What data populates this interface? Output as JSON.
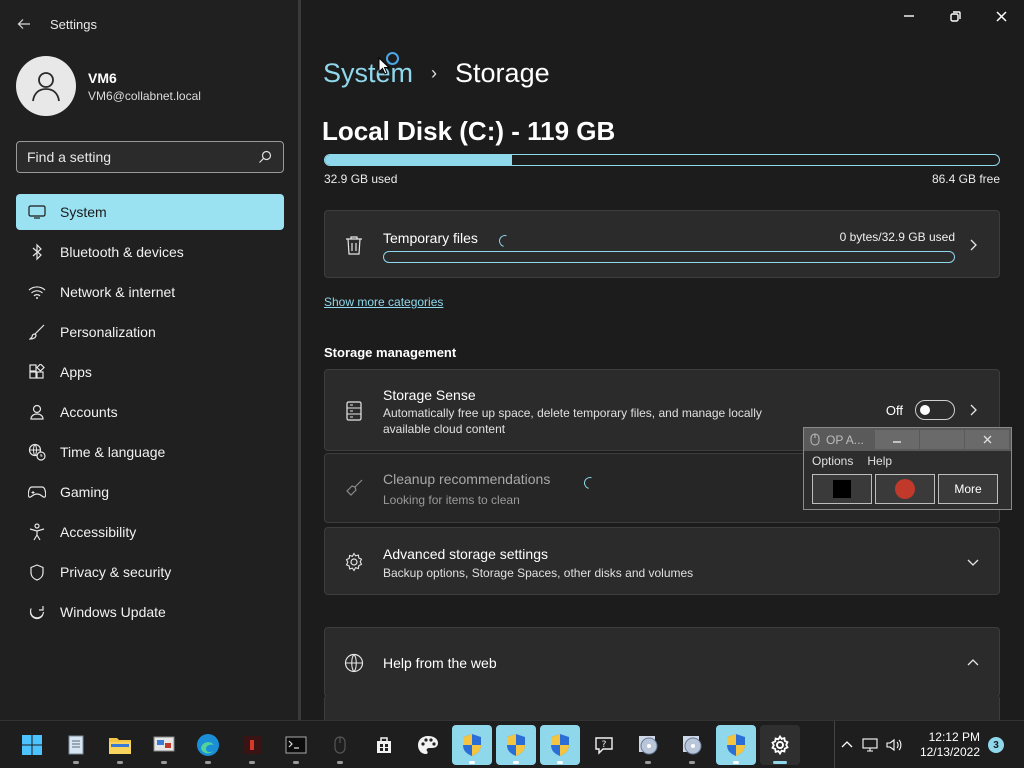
{
  "app": {
    "title": "Settings"
  },
  "user": {
    "name": "VM6",
    "email": "VM6@collabnet.local"
  },
  "search": {
    "placeholder": "Find a setting"
  },
  "nav": {
    "items": [
      {
        "label": "System",
        "icon": "monitor-icon",
        "active": true
      },
      {
        "label": "Bluetooth & devices",
        "icon": "bluetooth-icon"
      },
      {
        "label": "Network & internet",
        "icon": "wifi-icon"
      },
      {
        "label": "Personalization",
        "icon": "brush-icon"
      },
      {
        "label": "Apps",
        "icon": "apps-icon"
      },
      {
        "label": "Accounts",
        "icon": "person-icon"
      },
      {
        "label": "Time & language",
        "icon": "globe-clock-icon"
      },
      {
        "label": "Gaming",
        "icon": "gamepad-icon"
      },
      {
        "label": "Accessibility",
        "icon": "accessibility-icon"
      },
      {
        "label": "Privacy & security",
        "icon": "shield-icon"
      },
      {
        "label": "Windows Update",
        "icon": "update-icon"
      }
    ]
  },
  "breadcrumb": {
    "parent": "System",
    "separator": "›",
    "current": "Storage"
  },
  "disk": {
    "title": "Local Disk (C:) - 119 GB",
    "used_label": "32.9 GB used",
    "free_label": "86.4 GB free",
    "used_fraction": 0.277
  },
  "temp_files": {
    "label": "Temporary files",
    "value": "0 bytes/32.9 GB used"
  },
  "show_more": "Show more categories",
  "storage_management": {
    "heading": "Storage management",
    "sense": {
      "title": "Storage Sense",
      "desc_line1": "Automatically free up space, delete temporary files, and manage locally",
      "desc_line2": "available cloud content",
      "toggle_label": "Off"
    },
    "cleanup": {
      "title": "Cleanup recommendations",
      "desc": "Looking for items to clean"
    },
    "advanced": {
      "title": "Advanced storage settings",
      "desc": "Backup options, Storage Spaces, other disks and volumes"
    }
  },
  "help": {
    "title": "Help from the web"
  },
  "mini_window": {
    "title": "OP A...",
    "menu": [
      "Options",
      "Help"
    ],
    "more_label": "More"
  },
  "taskbar": {
    "time": "12:12 PM",
    "date": "12/13/2022",
    "notifications": "3"
  },
  "colors": {
    "accent": "#8fd8ec",
    "nav_active": "#9ae2f2",
    "background": "#1c1c1c",
    "card": "#2b2b2b"
  }
}
